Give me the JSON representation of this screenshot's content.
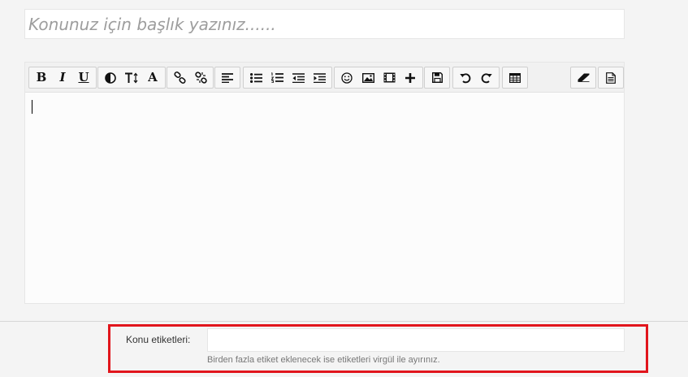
{
  "title_field": {
    "placeholder": "Konunuz için başlık yazınız......",
    "value": ""
  },
  "toolbar": {
    "groups": [
      [
        "bold-icon",
        "italic-icon",
        "underline-icon"
      ],
      [
        "text-color-icon",
        "font-size-icon",
        "font-family-icon"
      ],
      [
        "link-icon",
        "unlink-icon"
      ],
      [
        "align-icon"
      ],
      [
        "bullet-list-icon",
        "numbered-list-icon",
        "outdent-icon",
        "indent-icon"
      ],
      [
        "smiley-icon",
        "image-icon",
        "video-icon",
        "plus-icon"
      ],
      [
        "save-icon"
      ],
      [
        "undo-icon",
        "redo-icon"
      ],
      [
        "table-icon"
      ],
      [
        "eraser-icon"
      ],
      [
        "source-icon"
      ]
    ],
    "bold_label": "B",
    "italic_label": "I",
    "underline_label": "U",
    "font_family_label": "A"
  },
  "tags": {
    "label": "Konu etiketleri:",
    "value": "",
    "hint": "Birden fazla etiket eklenecek ise etiketleri virgül ile ayırınız."
  },
  "colors": {
    "highlight": "#e1151c",
    "background": "#f4f4f4",
    "field": "#ffffff"
  }
}
